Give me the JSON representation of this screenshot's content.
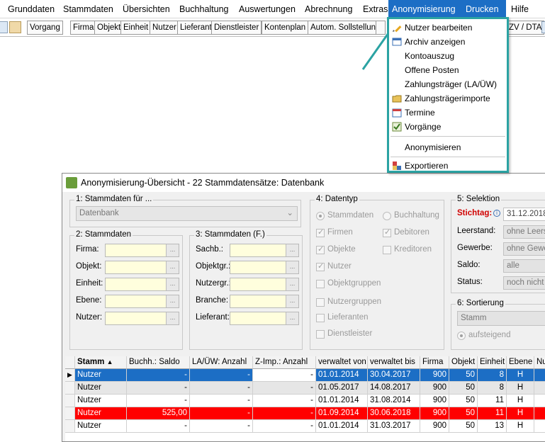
{
  "menubar": {
    "items": [
      "Grunddaten",
      "Stammdaten",
      "Übersichten",
      "Buchhaltung",
      "Auswertungen",
      "Abrechnung",
      "Extras",
      "Anonymisierung",
      "Drucken",
      "Hilfe"
    ]
  },
  "toolbar": {
    "buttons": [
      "Vorgang",
      "Firma",
      "Objekt",
      "Einheit",
      "Nutzer",
      "Lieferant",
      "Dienstleister",
      "Kontenplan",
      "Autom. Sollstellung",
      "ZV / DTA"
    ]
  },
  "dropdown": {
    "items": [
      {
        "label": "Nutzer bearbeiten",
        "icon": "pencil-icon"
      },
      {
        "label": "Archiv anzeigen",
        "icon": "archive-icon"
      },
      {
        "label": "Kontoauszug",
        "icon": ""
      },
      {
        "label": "Offene Posten",
        "icon": ""
      },
      {
        "label": "Zahlungsträger (LA/ÜW)",
        "icon": ""
      },
      {
        "label": "Zahlungsträgerimporte",
        "icon": "folder-icon"
      },
      {
        "label": "Termine",
        "icon": "calendar-icon"
      },
      {
        "label": "Vorgänge",
        "icon": "checklist-icon"
      },
      {
        "label": "Anonymisieren",
        "icon": ""
      },
      {
        "label": "Exportieren",
        "icon": "export-icon"
      }
    ]
  },
  "window": {
    "title": "Anonymisierung-Übersicht - 22 Stammdatensätze:  Datenbank",
    "stammdaten_fuer": {
      "title": "1: Stammdaten für ...",
      "value": "Datenbank"
    },
    "stammdaten": {
      "title": "2: Stammdaten",
      "labels": [
        "Firma:",
        "Objekt:",
        "Einheit:",
        "Ebene:",
        "Nutzer:"
      ]
    },
    "stammdaten_f": {
      "title": "3: Stammdaten (F.)",
      "labels": [
        "Sachb.:",
        "Objektgr.:",
        "Nutzergr.:",
        "Branche:",
        "Lieferant:"
      ]
    },
    "datentyp": {
      "title": "4: Datentyp",
      "radio_stamm": "Stammdaten",
      "radio_buch": "Buchhaltung",
      "checks": [
        "Firmen",
        "Debitoren",
        "Objekte",
        "Kreditoren",
        "Nutzer",
        "Objektgruppen",
        "Nutzergruppen",
        "Lieferanten",
        "Dienstleister"
      ]
    },
    "selektion": {
      "title": "5: Selektion",
      "stichtag_label": "Stichtag:",
      "stichtag_value": "31.12.2018",
      "leerstand_label": "Leerstand:",
      "leerstand_value": "ohne Leerst",
      "gewerbe_label": "Gewerbe:",
      "gewerbe_value": "ohne Gewe",
      "saldo_label": "Saldo:",
      "saldo_value": "alle",
      "status_label": "Status:",
      "status_value": "noch nicht a"
    },
    "sortierung": {
      "title": "6: Sortierung",
      "value": "Stamm",
      "order": "aufsteigend"
    }
  },
  "grid": {
    "headers": [
      "Stamm",
      "Buchh.: Saldo",
      "LA/ÜW: Anzahl",
      "Z-Imp.: Anzahl",
      "verwaltet von",
      "verwaltet bis",
      "Firma",
      "Objekt",
      "Einheit",
      "Ebene",
      "Nu"
    ],
    "rows": [
      {
        "stamm": "Nutzer",
        "saldo": "-",
        "la": "-",
        "zimp": "-",
        "von": "01.01.2014",
        "bis": "30.04.2017",
        "firma": "900",
        "objekt": "50",
        "einheit": "8",
        "ebene": "H",
        "style": "selected"
      },
      {
        "stamm": "Nutzer",
        "saldo": "-",
        "la": "-",
        "zimp": "-",
        "von": "01.05.2017",
        "bis": "14.08.2017",
        "firma": "900",
        "objekt": "50",
        "einheit": "8",
        "ebene": "H",
        "style": "gray"
      },
      {
        "stamm": "Nutzer",
        "saldo": "-",
        "la": "-",
        "zimp": "-",
        "von": "01.01.2014",
        "bis": "31.08.2014",
        "firma": "900",
        "objekt": "50",
        "einheit": "11",
        "ebene": "H",
        "style": "white"
      },
      {
        "stamm": "Nutzer",
        "saldo": "525,00",
        "la": "-",
        "zimp": "-",
        "von": "01.09.2014",
        "bis": "30.06.2018",
        "firma": "900",
        "objekt": "50",
        "einheit": "11",
        "ebene": "H",
        "style": "red"
      },
      {
        "stamm": "Nutzer",
        "saldo": "-",
        "la": "-",
        "zimp": "-",
        "von": "01.01.2014",
        "bis": "31.03.2017",
        "firma": "900",
        "objekt": "50",
        "einheit": "13",
        "ebene": "H",
        "style": "white"
      }
    ]
  },
  "colors": {
    "accent": "#1c6ec5",
    "highlight_red": "#ff0000",
    "callout": "#2ba3a3",
    "stichtag_red": "#d00000"
  }
}
